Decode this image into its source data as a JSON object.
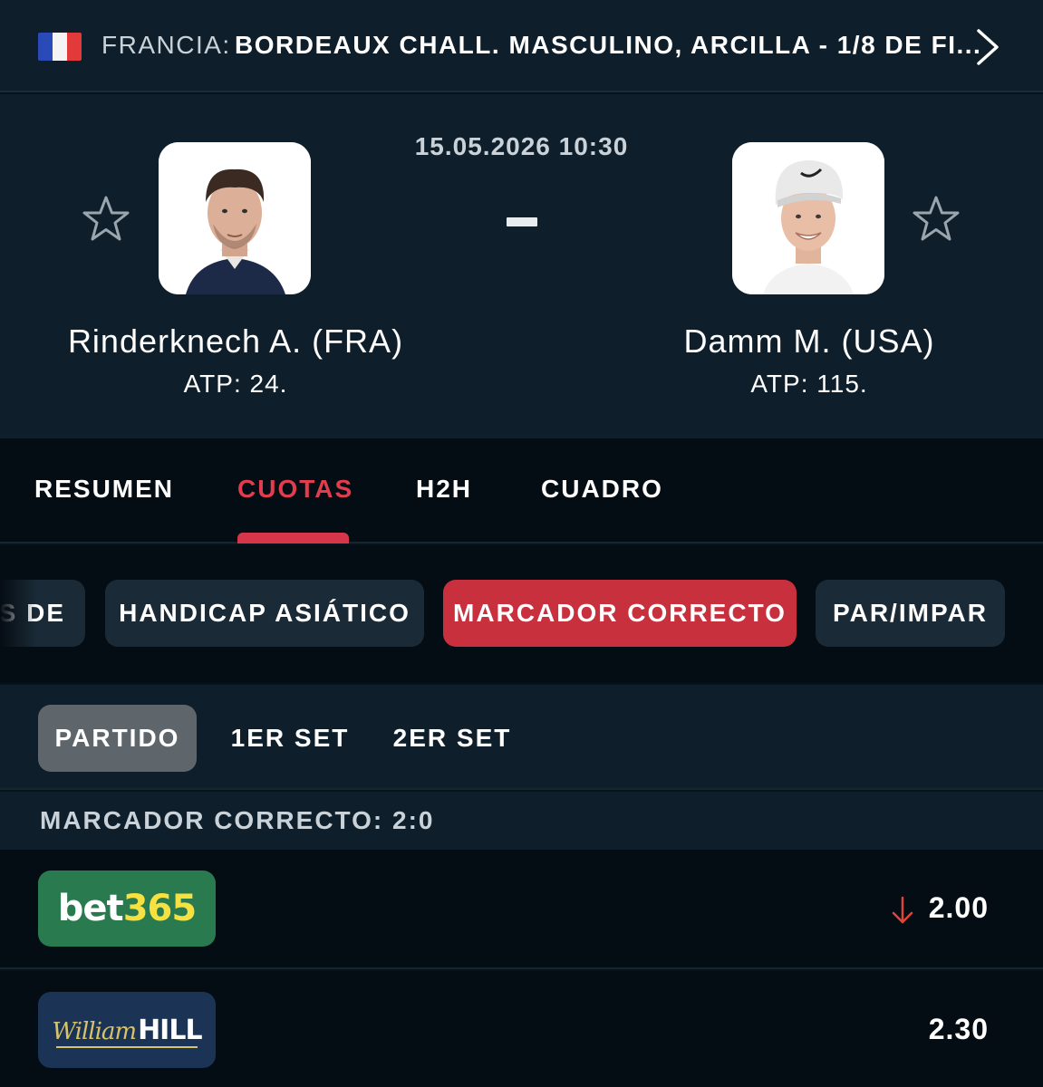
{
  "tournament": {
    "country": "FRANCIA:",
    "name": "BORDEAUX CHALL. MASCULINO, ARCILLA - 1/8 DE FI..."
  },
  "match": {
    "datetime": "15.05.2026 10:30",
    "score": "-",
    "home": {
      "name": "Rinderknech A. (FRA)",
      "rank": "ATP: 24."
    },
    "away": {
      "name": "Damm M. (USA)",
      "rank": "ATP: 115."
    }
  },
  "tabs": [
    {
      "label": "RESUMEN",
      "active": false
    },
    {
      "label": "CUOTAS",
      "active": true
    },
    {
      "label": "H2H",
      "active": false
    },
    {
      "label": "CUADRO",
      "active": false
    }
  ],
  "markets": [
    {
      "label": "S DE",
      "active": false
    },
    {
      "label": "HANDICAP ASIÁTICO",
      "active": false
    },
    {
      "label": "MARCADOR CORRECTO",
      "active": true
    },
    {
      "label": "PAR/IMPAR",
      "active": false
    }
  ],
  "periods": [
    {
      "label": "PARTIDO",
      "active": true
    },
    {
      "label": "1ER SET",
      "active": false
    },
    {
      "label": "2ER SET",
      "active": false
    }
  ],
  "section": {
    "title": "MARCADOR CORRECTO: 2:0"
  },
  "bookmakers": [
    {
      "logo_bet": "bet",
      "logo_num": "365",
      "odds": "2.00",
      "trend": "down"
    },
    {
      "logo_william": "William",
      "logo_hill": "HILL",
      "odds": "2.30",
      "trend": "none"
    }
  ],
  "colors": {
    "accent_red": "#c8303e",
    "tab_active": "#e23d4e",
    "trend_down": "#e0453a",
    "bet365_green": "#2a7a4f",
    "william_hill_navy": "#1b3456"
  },
  "icons": [
    "flag-france-icon",
    "chevron-right-icon",
    "star-icon",
    "arrow-down-icon"
  ]
}
